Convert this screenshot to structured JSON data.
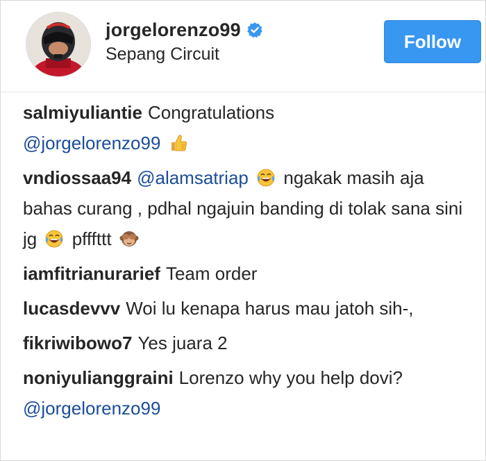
{
  "post": {
    "username": "jorgelorenzo99",
    "location": "Sepang Circuit",
    "follow_label": "Follow"
  },
  "colors": {
    "follow_button": "#3897f0",
    "verified_badge": "#3897f0",
    "mention": "#1b4d9a",
    "text": "#262626"
  },
  "comments": [
    {
      "username": "salmiyuliantie",
      "text": "Congratulations",
      "mention": "@jorgelorenzo99",
      "emoji": "thumbs-up-emoji"
    },
    {
      "username": "vndiossaa94",
      "mention": "@alamsatriap",
      "text_a": "ngakak masih aja bahas curang , pdhal ngajuin banding di tolak sana sini jg",
      "text_b": "pfffttt",
      "emojis": [
        "face-with-tears-of-joy-emoji",
        "face-with-tears-of-joy-emoji",
        "see-no-evil-monkey-emoji"
      ]
    },
    {
      "username": "iamfitrianurarief",
      "text": "Team order"
    },
    {
      "username": "lucasdevvv",
      "text": "Woi lu kenapa harus mau jatoh sih-,"
    },
    {
      "username": "fikriwibowo7",
      "text": "Yes juara 2"
    },
    {
      "username": "noniyulianggraini",
      "text": "Lorenzo why you help dovi?",
      "mention": "@jorgelorenzo99"
    }
  ]
}
